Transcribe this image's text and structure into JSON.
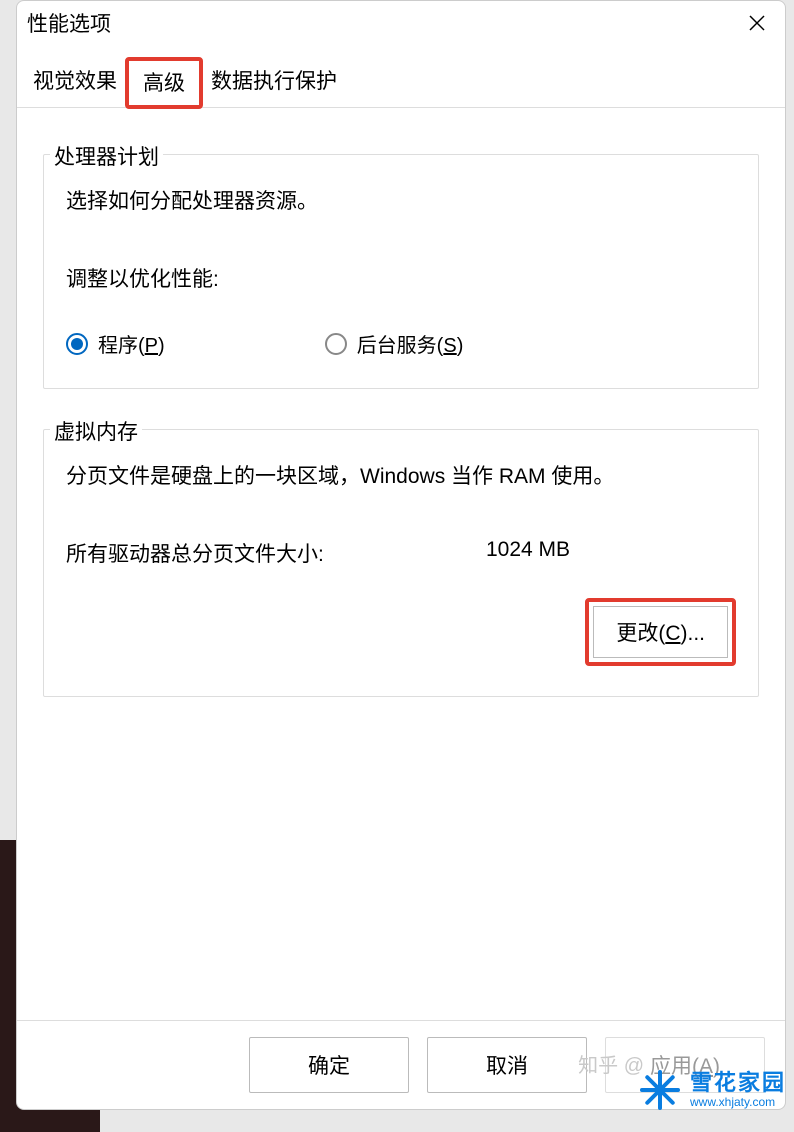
{
  "dialog": {
    "title": "性能选项",
    "close_label": "关闭"
  },
  "tabs": {
    "visual": "视觉效果",
    "advanced": "高级",
    "dep": "数据执行保护"
  },
  "processor": {
    "legend": "处理器计划",
    "desc": "选择如何分配处理器资源。",
    "sub": "调整以优化性能:",
    "programs_pre": "程序(",
    "programs_u": "P",
    "programs_post": ")",
    "services_pre": "后台服务(",
    "services_u": "S",
    "services_post": ")",
    "selected": "programs"
  },
  "vm": {
    "legend": "虚拟内存",
    "desc": "分页文件是硬盘上的一块区域，Windows 当作 RAM 使用。",
    "total_label": "所有驱动器总分页文件大小:",
    "total_value": "1024 MB",
    "change_pre": "更改(",
    "change_u": "C",
    "change_post": ")..."
  },
  "buttons": {
    "ok": "确定",
    "cancel": "取消",
    "apply_pre": "应用(",
    "apply_u": "A",
    "apply_post": ")"
  },
  "watermarks": {
    "zhihu": "知乎 @",
    "brand": "雪花家园",
    "url": "www.xhjaty.com"
  }
}
